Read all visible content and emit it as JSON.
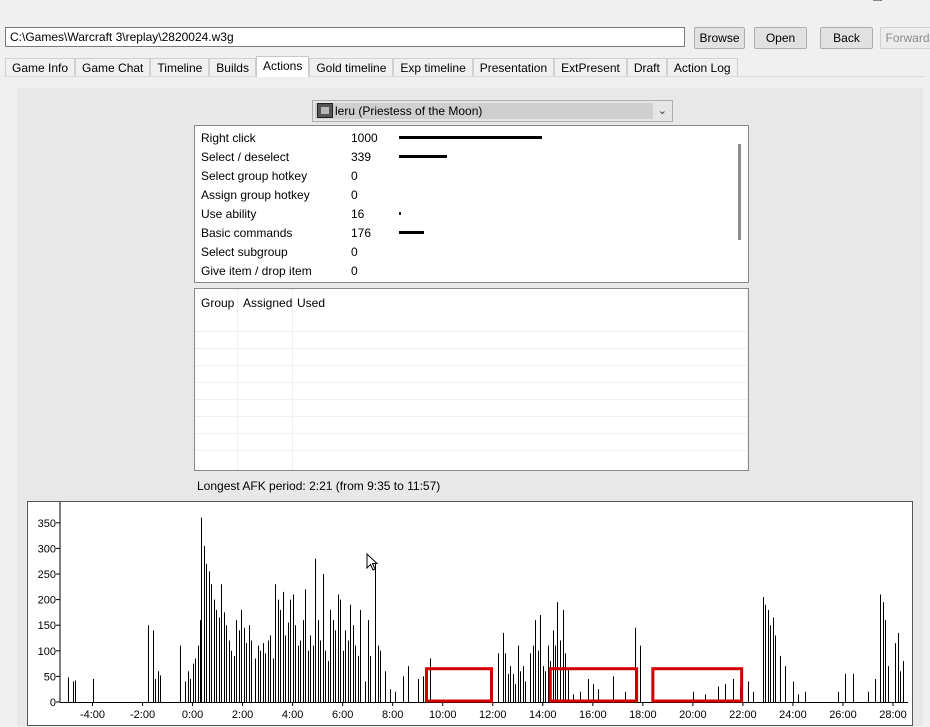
{
  "window": {
    "controls": {
      "minimize": "—",
      "maximize": "□",
      "close": "✕"
    }
  },
  "toolbar": {
    "path_value": "C:\\Games\\Warcraft 3\\replay\\2820024.w3g",
    "browse_label": "Browse",
    "open_label": "Open",
    "back_label": "Back",
    "forward_label": "Forward"
  },
  "tabs": [
    {
      "label": "Game Info"
    },
    {
      "label": "Game Chat"
    },
    {
      "label": "Timeline"
    },
    {
      "label": "Builds"
    },
    {
      "label": "Actions",
      "active": true
    },
    {
      "label": "Gold timeline"
    },
    {
      "label": "Exp timeline"
    },
    {
      "label": "Presentation"
    },
    {
      "label": "ExtPresent"
    },
    {
      "label": "Draft"
    },
    {
      "label": "Action Log"
    }
  ],
  "player_select": {
    "selected": "leru (Priestess of the Moon)",
    "icon": "priestess-hero-icon"
  },
  "actions": [
    {
      "name": "Right click",
      "count": 1000
    },
    {
      "name": "Select / deselect",
      "count": 339
    },
    {
      "name": "Select group hotkey",
      "count": 0
    },
    {
      "name": "Assign group hotkey",
      "count": 0
    },
    {
      "name": "Use ability",
      "count": 16
    },
    {
      "name": "Basic commands",
      "count": 176
    },
    {
      "name": "Select subgroup",
      "count": 0
    },
    {
      "name": "Give item / drop item",
      "count": 0
    }
  ],
  "groups_table": {
    "headers": [
      "Group",
      "Assigned",
      "Used"
    ],
    "rows": []
  },
  "afk_text": "Longest AFK period: 2:21 (from 9:35 to 11:57)",
  "colors": {
    "bar": "#000000",
    "afk_highlight": "#d40000"
  },
  "chart_data": {
    "type": "bar",
    "y_ticks": [
      0,
      50,
      100,
      150,
      200,
      250,
      300,
      350
    ],
    "x_tick_labels": [
      "-4:00",
      "-2:00",
      "0:00",
      "2:00",
      "4:00",
      "6:00",
      "8:00",
      "10:00",
      "12:00",
      "14:00",
      "16:00",
      "18:00",
      "20:00",
      "22:00",
      "24:00",
      "26:00",
      "28:00"
    ],
    "x_tick_minutes": [
      -4,
      -2,
      0,
      2,
      4,
      6,
      8,
      10,
      12,
      14,
      16,
      18,
      20,
      22,
      24,
      26,
      28
    ],
    "xlim_minutes": [
      -5.3,
      28.6
    ],
    "ylim": [
      0,
      375
    ],
    "bars": [
      [
        -5.0,
        48
      ],
      [
        -4.8,
        40
      ],
      [
        -4.7,
        42
      ],
      [
        -4.0,
        45
      ],
      [
        -1.8,
        150
      ],
      [
        -1.6,
        140
      ],
      [
        -1.5,
        45
      ],
      [
        -1.4,
        60
      ],
      [
        -1.3,
        52
      ],
      [
        -0.5,
        110
      ],
      [
        -0.3,
        40
      ],
      [
        -0.2,
        60
      ],
      [
        -0.1,
        45
      ],
      [
        0.0,
        75
      ],
      [
        0.1,
        85
      ],
      [
        0.2,
        110
      ],
      [
        0.3,
        160
      ],
      [
        0.35,
        360
      ],
      [
        0.45,
        305
      ],
      [
        0.55,
        270
      ],
      [
        0.65,
        255
      ],
      [
        0.75,
        230
      ],
      [
        0.85,
        200
      ],
      [
        0.95,
        180
      ],
      [
        1.05,
        165
      ],
      [
        1.15,
        230
      ],
      [
        1.25,
        175
      ],
      [
        1.35,
        150
      ],
      [
        1.45,
        120
      ],
      [
        1.55,
        100
      ],
      [
        1.65,
        90
      ],
      [
        1.75,
        160
      ],
      [
        1.85,
        140
      ],
      [
        1.95,
        180
      ],
      [
        2.05,
        145
      ],
      [
        2.15,
        115
      ],
      [
        2.25,
        150
      ],
      [
        2.35,
        120
      ],
      [
        2.5,
        85
      ],
      [
        2.6,
        110
      ],
      [
        2.7,
        100
      ],
      [
        2.8,
        115
      ],
      [
        2.9,
        95
      ],
      [
        3.0,
        120
      ],
      [
        3.1,
        130
      ],
      [
        3.2,
        85
      ],
      [
        3.3,
        230
      ],
      [
        3.4,
        200
      ],
      [
        3.5,
        180
      ],
      [
        3.6,
        215
      ],
      [
        3.7,
        130
      ],
      [
        3.8,
        155
      ],
      [
        3.9,
        200
      ],
      [
        4.0,
        210
      ],
      [
        4.1,
        150
      ],
      [
        4.2,
        110
      ],
      [
        4.3,
        120
      ],
      [
        4.4,
        160
      ],
      [
        4.5,
        220
      ],
      [
        4.6,
        100
      ],
      [
        4.7,
        130
      ],
      [
        4.8,
        110
      ],
      [
        4.9,
        280
      ],
      [
        5.0,
        160
      ],
      [
        5.1,
        120
      ],
      [
        5.2,
        250
      ],
      [
        5.3,
        100
      ],
      [
        5.4,
        80
      ],
      [
        5.5,
        180
      ],
      [
        5.6,
        160
      ],
      [
        5.7,
        140
      ],
      [
        5.8,
        210
      ],
      [
        5.9,
        200
      ],
      [
        6.0,
        100
      ],
      [
        6.1,
        140
      ],
      [
        6.2,
        120
      ],
      [
        6.3,
        190
      ],
      [
        6.4,
        150
      ],
      [
        6.5,
        110
      ],
      [
        6.6,
        90
      ],
      [
        6.7,
        180
      ],
      [
        6.9,
        40
      ],
      [
        7.0,
        160
      ],
      [
        7.1,
        90
      ],
      [
        7.3,
        270
      ],
      [
        7.4,
        110
      ],
      [
        7.5,
        100
      ],
      [
        7.7,
        60
      ],
      [
        7.9,
        25
      ],
      [
        8.1,
        20
      ],
      [
        8.4,
        50
      ],
      [
        8.6,
        70
      ],
      [
        9.0,
        45
      ],
      [
        9.2,
        50
      ],
      [
        9.35,
        40
      ],
      [
        9.5,
        85
      ],
      [
        12.2,
        95
      ],
      [
        12.4,
        135
      ],
      [
        12.5,
        95
      ],
      [
        12.6,
        55
      ],
      [
        12.7,
        70
      ],
      [
        12.8,
        55
      ],
      [
        12.9,
        35
      ],
      [
        13.0,
        110
      ],
      [
        13.1,
        60
      ],
      [
        13.2,
        70
      ],
      [
        13.3,
        40
      ],
      [
        13.5,
        95
      ],
      [
        13.6,
        110
      ],
      [
        13.7,
        160
      ],
      [
        13.8,
        100
      ],
      [
        13.9,
        170
      ],
      [
        14.0,
        70
      ],
      [
        14.1,
        60
      ],
      [
        14.2,
        110
      ],
      [
        14.3,
        80
      ],
      [
        14.4,
        140
      ],
      [
        14.5,
        110
      ],
      [
        14.55,
        195
      ],
      [
        14.7,
        120
      ],
      [
        14.8,
        180
      ],
      [
        14.9,
        95
      ],
      [
        15.0,
        65
      ],
      [
        15.2,
        15
      ],
      [
        15.5,
        20
      ],
      [
        15.8,
        45
      ],
      [
        16.0,
        35
      ],
      [
        16.2,
        25
      ],
      [
        16.8,
        50
      ],
      [
        17.3,
        20
      ],
      [
        17.7,
        145
      ],
      [
        17.9,
        110
      ],
      [
        20.0,
        20
      ],
      [
        20.5,
        15
      ],
      [
        21.0,
        30
      ],
      [
        21.3,
        35
      ],
      [
        21.6,
        45
      ],
      [
        21.9,
        30
      ],
      [
        22.2,
        40
      ],
      [
        22.4,
        20
      ],
      [
        22.8,
        205
      ],
      [
        22.9,
        190
      ],
      [
        23.0,
        180
      ],
      [
        23.1,
        150
      ],
      [
        23.2,
        165
      ],
      [
        23.3,
        130
      ],
      [
        23.5,
        90
      ],
      [
        23.7,
        70
      ],
      [
        24.0,
        40
      ],
      [
        24.2,
        15
      ],
      [
        24.5,
        20
      ],
      [
        25.8,
        20
      ],
      [
        26.1,
        55
      ],
      [
        26.4,
        55
      ],
      [
        27.0,
        20
      ],
      [
        27.3,
        45
      ],
      [
        27.5,
        210
      ],
      [
        27.6,
        195
      ],
      [
        27.7,
        160
      ],
      [
        27.8,
        70
      ],
      [
        28.1,
        115
      ],
      [
        28.2,
        135
      ],
      [
        28.3,
        60
      ],
      [
        28.4,
        80
      ]
    ],
    "afk_highlights": [
      {
        "from_minutes": 9.35,
        "to_minutes": 11.95
      },
      {
        "from_minutes": 14.3,
        "to_minutes": 17.75
      },
      {
        "from_minutes": 18.4,
        "to_minutes": 21.95
      }
    ]
  }
}
